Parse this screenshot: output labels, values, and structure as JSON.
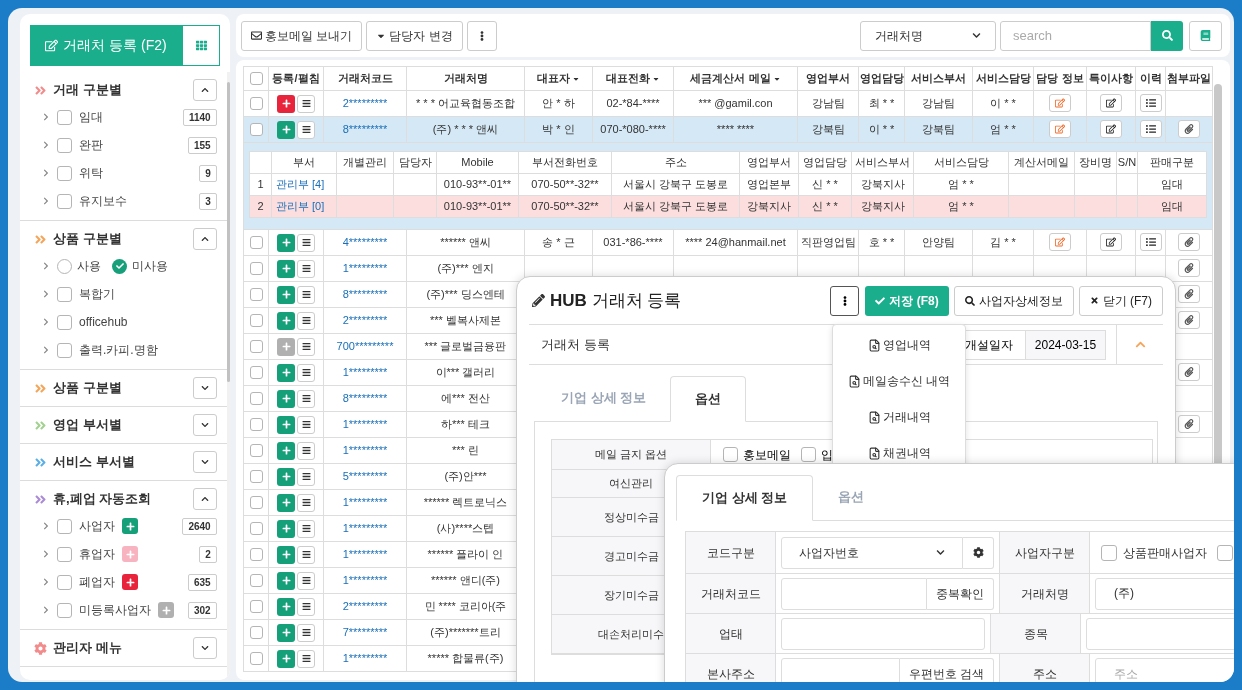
{
  "sidebar": {
    "register_button": "거래처 등록 (F2)",
    "sections": [
      {
        "kind": "arrows",
        "title": "거래 구분별",
        "color": "#f28b8b",
        "expanded": true,
        "items": [
          {
            "kind": "checkbox",
            "label": "임대",
            "checked": false,
            "count": "1140"
          },
          {
            "kind": "checkbox",
            "label": "완판",
            "checked": false,
            "count": "155"
          },
          {
            "kind": "checkbox",
            "label": "위탁",
            "checked": false,
            "count": "9"
          },
          {
            "kind": "checkbox",
            "label": "유지보수",
            "checked": false,
            "count": "3"
          }
        ]
      },
      {
        "kind": "arrows",
        "title": "상품 구분별",
        "color": "#f5a55a",
        "expanded": true,
        "items": [
          {
            "kind": "radio",
            "options": [
              {
                "label": "사용",
                "selected": false
              },
              {
                "label": "미사용",
                "selected": true
              }
            ]
          },
          {
            "kind": "checkbox",
            "label": "복합기",
            "checked": false
          },
          {
            "kind": "checkbox",
            "label": "officehub",
            "checked": false
          },
          {
            "kind": "checkbox",
            "label": "출력.카피.명함",
            "checked": false
          }
        ]
      },
      {
        "kind": "arrows",
        "title": "상품 구분별",
        "color": "#f5a55a",
        "expanded": false
      },
      {
        "kind": "arrows",
        "title": "영업 부서별",
        "color": "#a3d18f",
        "expanded": false
      },
      {
        "kind": "arrows",
        "title": "서비스 부서별",
        "color": "#5eaee6",
        "expanded": false
      },
      {
        "kind": "arrows",
        "title": "휴,폐업 자동조회",
        "color": "#a98bd6",
        "expanded": true,
        "items": [
          {
            "kind": "checkbox",
            "label": "사업자",
            "checked": false,
            "color": "#16a07a",
            "count": "2640"
          },
          {
            "kind": "checkbox",
            "label": "휴업자",
            "checked": false,
            "color": "#f7b3bf",
            "count": "2"
          },
          {
            "kind": "checkbox",
            "label": "폐업자",
            "checked": false,
            "color": "#e8243c",
            "count": "635"
          },
          {
            "kind": "checkbox",
            "label": "미등록사업자",
            "checked": false,
            "color": "#b0b0b0",
            "count": "302"
          }
        ]
      },
      {
        "kind": "gear",
        "title": "관리자 메뉴",
        "color": "#f28b8b",
        "expanded": false
      }
    ]
  },
  "toolbar": {
    "buttons": [
      {
        "kind": "mail",
        "label": "홍보메일 보내기"
      },
      {
        "kind": "caret",
        "label": "담당자 변경"
      },
      {
        "kind": "more"
      }
    ],
    "search": {
      "field": "거래처명",
      "placeholder": "search"
    }
  },
  "table": {
    "select_all": false,
    "columns": [
      {
        "label": "등록/펼침",
        "sortable": false
      },
      {
        "label": "거래처코드",
        "sortable": false
      },
      {
        "label": "거래처명",
        "sortable": false
      },
      {
        "label": "대표자",
        "sortable": true
      },
      {
        "label": "대표전화",
        "sortable": true
      },
      {
        "label": "세금계산서 메일",
        "sortable": true
      },
      {
        "label": "영업부서",
        "sortable": false
      },
      {
        "label": "영업담당",
        "sortable": false
      },
      {
        "label": "서비스부서",
        "sortable": false
      },
      {
        "label": "서비스담당",
        "sortable": false
      },
      {
        "label": "담당 정보",
        "sortable": false
      },
      {
        "label": "특이사항",
        "sortable": false
      },
      {
        "label": "이력",
        "sortable": false
      },
      {
        "label": "첨부파일",
        "sortable": false
      }
    ],
    "rows": [
      {
        "color": "#e8243c",
        "expanded": false,
        "checked": false,
        "code": "2*********",
        "name": "* * * 어교육협동조합",
        "cells": [
          "안 * 하",
          "02-*84-****",
          "*** @gamil.con",
          "강남팀",
          "최 * *",
          "강남팀",
          "이 * *"
        ],
        "icons": [
          {
            "kind": "contact"
          },
          {
            "kind": "note"
          },
          {
            "kind": "history"
          }
        ]
      },
      {
        "color": "#16a07a",
        "expanded": true,
        "checked": false,
        "code": "8*********",
        "name": "(주)  * * * 앤씨",
        "cells": [
          "박 * 인",
          "070-*080-****",
          "**** ****",
          "강북팀",
          "이 * *",
          "강북팀",
          "엄 * *"
        ],
        "icons": [
          {
            "kind": "contact"
          },
          {
            "kind": "note"
          },
          {
            "kind": "history"
          },
          {
            "kind": "attachment"
          }
        ],
        "detail": {
          "columns": [
            "부서",
            "개별관리",
            "담당자",
            "Mobile",
            "부서전화번호",
            "주소",
            "영업부서",
            "영업담당",
            "서비스부서",
            "서비스담당",
            "계산서메일",
            "장비명",
            "S/N",
            "판매구분"
          ],
          "rows": [
            {
              "number": "1",
              "selected": false,
              "cells": [
                "관리부 [4]",
                null,
                null,
                "010-93**-01**",
                "070-50**-32**",
                "서울시 강북구 도봉로",
                "영업본부",
                "신 * *",
                "강북지사",
                "엄 * *",
                null,
                null,
                null,
                "임대"
              ]
            },
            {
              "number": "2",
              "selected": true,
              "cells": [
                "관리부 [0]",
                null,
                null,
                "010-93**-01**",
                "070-50**-32**",
                "서울시 강북구 도봉로",
                "강북지사",
                "신 * *",
                "강북지사",
                "엄 * *",
                null,
                null,
                null,
                "임대"
              ]
            }
          ]
        }
      },
      {
        "color": "#16a07a",
        "expanded": false,
        "checked": false,
        "code": "4*********",
        "name": "****** 앤씨",
        "cells": [
          "송 * 근",
          "031-*86-****",
          "**** 24@hanmail.net",
          "직판영업팀",
          "호 * *",
          "안양팀",
          "김 * *"
        ],
        "icons": [
          {
            "kind": "contact"
          },
          {
            "kind": "note"
          },
          {
            "kind": "history"
          },
          {
            "kind": "attachment"
          }
        ]
      },
      {
        "color": "#16a07a",
        "expanded": false,
        "checked": false,
        "code": "1*********",
        "name": "(주)*** 엔지",
        "icons": [
          {
            "kind": "attachment"
          }
        ]
      },
      {
        "color": "#16a07a",
        "expanded": false,
        "checked": false,
        "code": "8*********",
        "name": "(주)*** 딩스엔테",
        "icons": [
          {
            "kind": "attachment"
          }
        ]
      },
      {
        "color": "#16a07a",
        "expanded": false,
        "checked": false,
        "code": "2*********",
        "name": "*** 벨복사제본",
        "icons": [
          {
            "kind": "attachment"
          }
        ]
      },
      {
        "color": "#b0b0b0",
        "expanded": false,
        "checked": false,
        "code": "700*********",
        "name": "*** 글로벌금융판"
      },
      {
        "color": "#16a07a",
        "expanded": false,
        "checked": false,
        "code": "1*********",
        "name": "이*** 갤러리",
        "icons": [
          {
            "kind": "attachment"
          }
        ]
      },
      {
        "color": "#16a07a",
        "expanded": false,
        "checked": false,
        "code": "8*********",
        "name": "에*** 전산"
      },
      {
        "color": "#16a07a",
        "expanded": false,
        "checked": false,
        "code": "1*********",
        "name": "하*** 테크",
        "icons": [
          {
            "kind": "attachment"
          }
        ]
      },
      {
        "color": "#16a07a",
        "expanded": false,
        "checked": false,
        "code": "1*********",
        "name": "*** 린"
      },
      {
        "color": "#16a07a",
        "expanded": false,
        "checked": false,
        "code": "5*********",
        "name": "(주)안***"
      },
      {
        "color": "#16a07a",
        "expanded": false,
        "checked": false,
        "code": "1*********",
        "name": "****** 렉트로닉스"
      },
      {
        "color": "#16a07a",
        "expanded": false,
        "checked": false,
        "code": "1*********",
        "name": "(사)****스텝"
      },
      {
        "color": "#16a07a",
        "expanded": false,
        "checked": false,
        "code": "1*********",
        "name": "****** 플라이 인"
      },
      {
        "color": "#16a07a",
        "expanded": false,
        "checked": false,
        "code": "1*********",
        "name": "****** 앤디(주)"
      },
      {
        "color": "#16a07a",
        "expanded": false,
        "checked": false,
        "code": "2*********",
        "name": "민 **** 코리아(주"
      },
      {
        "color": "#16a07a",
        "expanded": false,
        "checked": false,
        "code": "7*********",
        "name": "(주)*******트리"
      },
      {
        "color": "#16a07a",
        "expanded": false,
        "checked": false,
        "code": "1*********",
        "name": "***** 합물류(주)"
      }
    ]
  },
  "register_dialog": {
    "title": "**HUB** 거래처 등록",
    "buttons": [
      {
        "kind": "more"
      },
      {
        "kind": "save",
        "label": "저장 (F8)"
      },
      {
        "kind": "search",
        "label": "사업자상세정보"
      },
      {
        "kind": "close",
        "label": "닫기 (F7)"
      }
    ],
    "menu": [
      "영업내역",
      "메일송수신 내역",
      "거래내역",
      "채권내역"
    ],
    "section": {
      "title": "거래처 등록",
      "expanded": true,
      "date_label": "개설일자",
      "date": "2024-03-15"
    },
    "tabs": [
      {
        "label": "기업 상세 정보",
        "selected": false
      },
      {
        "label": "옵션",
        "selected": true
      }
    ],
    "option_rows": [
      {
        "label": "메일 금지 옵션",
        "checkboxes": [
          {
            "label": "홍보메일",
            "checked": false
          },
          {
            "label": "입",
            "checked": false
          }
        ]
      },
      {
        "label": "여신관리"
      },
      {
        "label": "정상미수금"
      },
      {
        "label": "경고미수금"
      },
      {
        "label": "장기미수금"
      },
      {
        "label": "대손처리미수"
      }
    ]
  },
  "detail_dialog": {
    "tabs": [
      {
        "label": "기업 상세 정보",
        "selected": true
      },
      {
        "label": "옵션",
        "selected": false
      }
    ],
    "form": [
      [
        {
          "label": "코드구분",
          "kind": "select",
          "value": "사업자번호"
        },
        {
          "label": "사업자구분",
          "kind": "checkboxes",
          "checkboxes": [
            {
              "label": "상품판매사업자",
              "checked": false
            },
            {
              "checked": false
            }
          ]
        }
      ],
      [
        {
          "label": "거래처코드",
          "kind": "input_button",
          "button": "중복확인"
        },
        {
          "label": "거래처명",
          "kind": "input",
          "value": "(주)"
        }
      ],
      [
        {
          "label": "업태",
          "kind": "input"
        },
        {
          "label": "종목",
          "kind": "input"
        }
      ],
      [
        {
          "label": "본사주소",
          "kind": "input_button",
          "button": "우편번호 검색"
        },
        {
          "label": "주소",
          "kind": "input",
          "placeholder": "주소"
        }
      ]
    ]
  }
}
